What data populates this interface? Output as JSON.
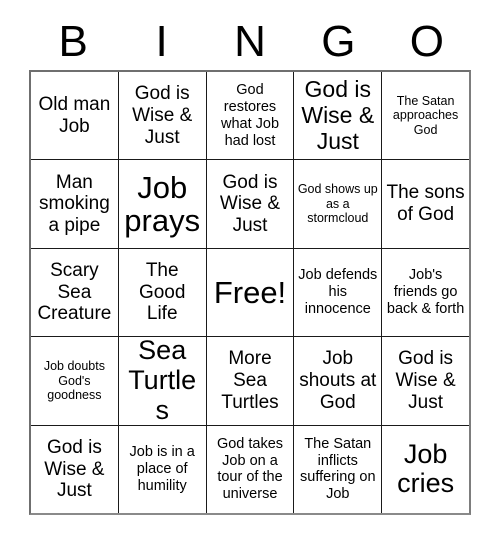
{
  "card": {
    "title": "Bingo Card",
    "header_letters": [
      "B",
      "I",
      "N",
      "G",
      "O"
    ],
    "background_color": "#ffffff",
    "text_color": "#000000",
    "border_color": "#1a1a1a",
    "outer_border_color": "#6f6f6f",
    "columns": 5,
    "rows": 5,
    "free_space": {
      "row": 2,
      "column": 2,
      "label": "Free!"
    },
    "cells": [
      [
        {
          "text": "Old man Job",
          "size": "md"
        },
        {
          "text": "God is Wise & Just",
          "size": "md"
        },
        {
          "text": "God restores what Job had lost",
          "size": "sm"
        },
        {
          "text": "God is Wise & Just",
          "size": "lg"
        },
        {
          "text": "The Satan approaches God",
          "size": "xs"
        }
      ],
      [
        {
          "text": "Man smoking a pipe",
          "size": "md"
        },
        {
          "text": "Job prays",
          "size": "xxl"
        },
        {
          "text": "God is Wise & Just",
          "size": "md"
        },
        {
          "text": "God shows up as a stormcloud",
          "size": "xs"
        },
        {
          "text": "The sons of God",
          "size": "md"
        }
      ],
      [
        {
          "text": "Scary Sea Creature",
          "size": "md"
        },
        {
          "text": "The Good Life",
          "size": "md"
        },
        {
          "text": "Free!",
          "size": "xxl"
        },
        {
          "text": "Job defends his innocence",
          "size": "sm"
        },
        {
          "text": "Job's friends go back & forth",
          "size": "sm"
        }
      ],
      [
        {
          "text": "Job doubts God's goodness",
          "size": "xs"
        },
        {
          "text": "Sea Turtles",
          "size": "xl"
        },
        {
          "text": "More Sea Turtles",
          "size": "md"
        },
        {
          "text": "Job shouts at God",
          "size": "md"
        },
        {
          "text": "God is Wise & Just",
          "size": "md"
        }
      ],
      [
        {
          "text": "God is Wise & Just",
          "size": "md"
        },
        {
          "text": "Job is in a place of humility",
          "size": "sm"
        },
        {
          "text": "God takes Job on a tour of the universe",
          "size": "sm"
        },
        {
          "text": "The Satan inflicts suffering on Job",
          "size": "sm"
        },
        {
          "text": "Job cries",
          "size": "xl"
        }
      ]
    ]
  }
}
